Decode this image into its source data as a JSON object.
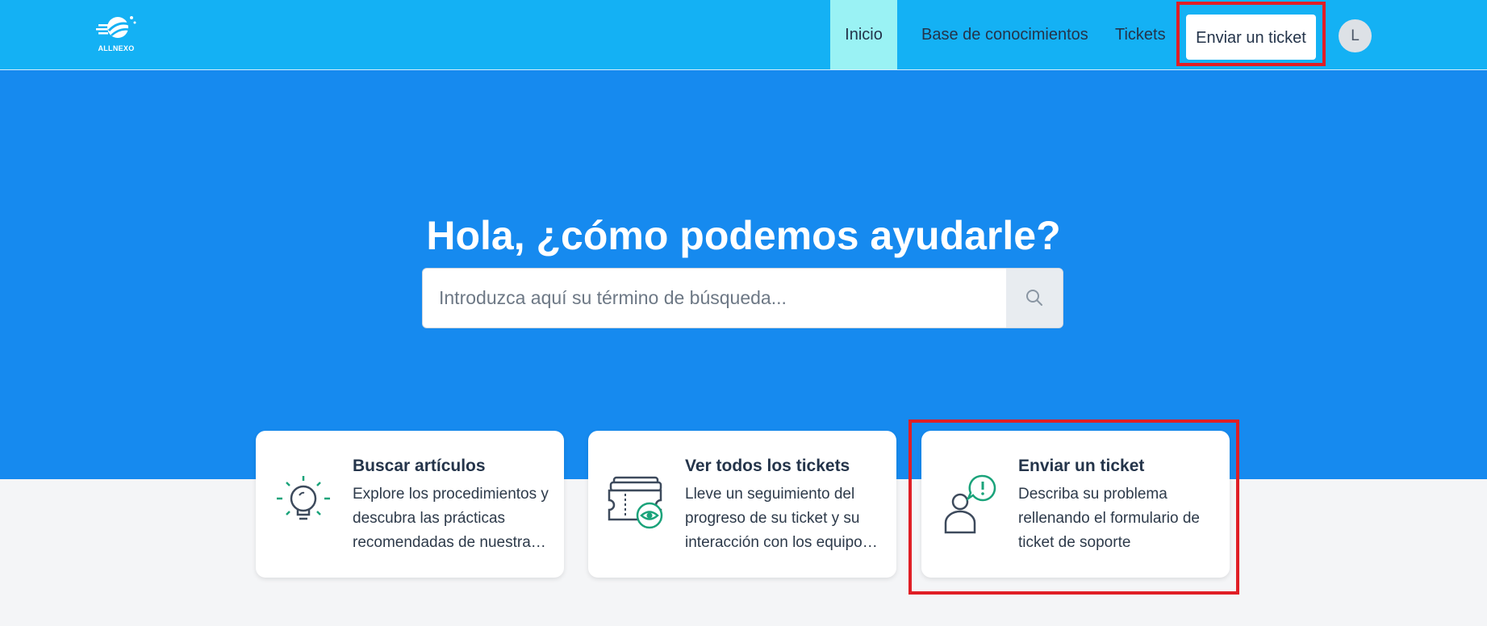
{
  "brand": {
    "logo_text": "ALLNEXO"
  },
  "nav": {
    "items": [
      {
        "label": "Inicio",
        "active": true
      },
      {
        "label": "Base de conocimientos"
      },
      {
        "label": "Tickets"
      }
    ],
    "submit_label": "Enviar un ticket",
    "avatar_initial": "L"
  },
  "hero": {
    "title": "Hola, ¿cómo podemos ayudarle?",
    "search_placeholder": "Introduzca aquí su término de búsqueda..."
  },
  "cards": [
    {
      "icon": "lightbulb-icon",
      "title": "Buscar artículos",
      "description": "Explore los procedimientos y descubra las prácticas recomendadas de nuestra base de conocimientos"
    },
    {
      "icon": "ticket-eye-icon",
      "title": "Ver todos los tickets",
      "description": "Lleve un seguimiento del progreso de su ticket y su interacción con los equipos de soporte"
    },
    {
      "icon": "person-alert-icon",
      "title": "Enviar un ticket",
      "description": "Describa su problema rellenando el formulario de ticket de soporte"
    }
  ],
  "colors": {
    "topbar": "#14b1f4",
    "hero": "#168aef",
    "active_nav": "#9af2f4",
    "icon_accent": "#1aa37a",
    "icon_dark": "#3d4a5c",
    "highlight": "#e01e25"
  }
}
